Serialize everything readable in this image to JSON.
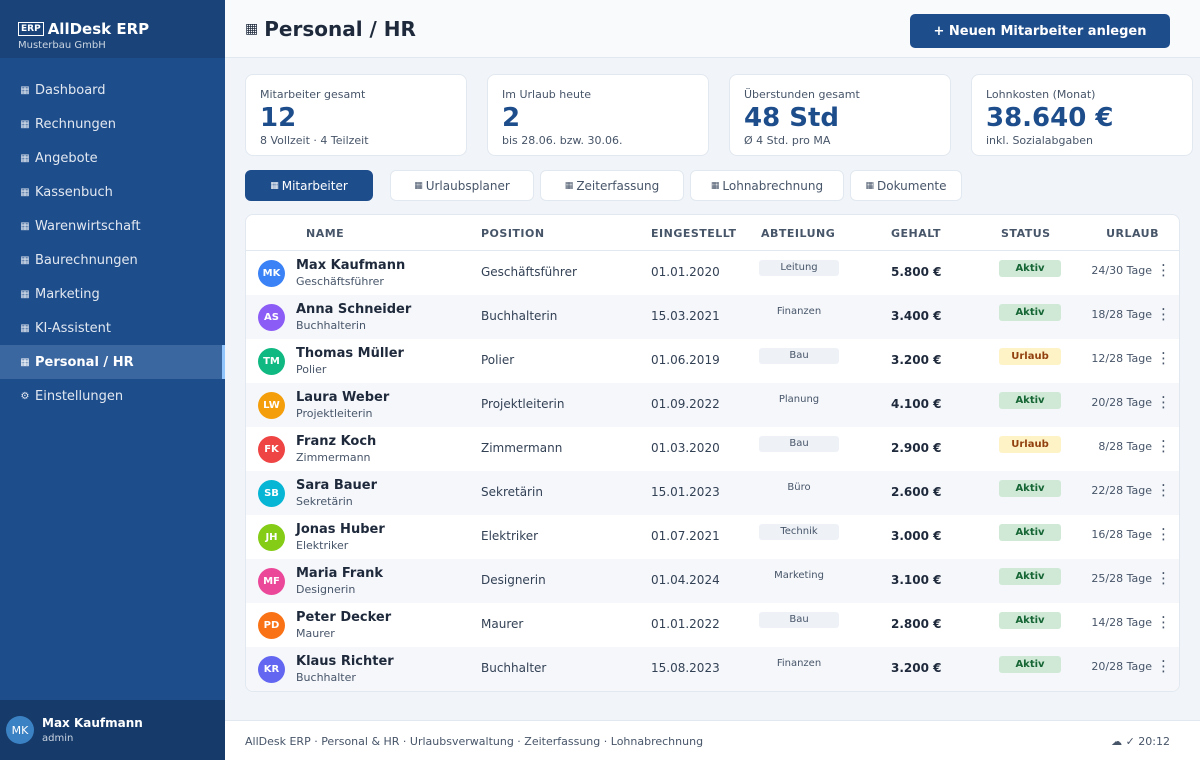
{
  "app": {
    "icon": "ERP",
    "name": "AllDesk ERP",
    "company": "Musterbau GmbH"
  },
  "sidebar": {
    "items": [
      {
        "icon": "▦",
        "label": "Dashboard"
      },
      {
        "icon": "▦",
        "label": "Rechnungen"
      },
      {
        "icon": "▦",
        "label": "Angebote"
      },
      {
        "icon": "▦",
        "label": "Kassenbuch"
      },
      {
        "icon": "▦",
        "label": "Warenwirtschaft"
      },
      {
        "icon": "▦",
        "label": "Baurechnungen"
      },
      {
        "icon": "▦",
        "label": "Marketing"
      },
      {
        "icon": "▦",
        "label": "KI-Assistent"
      },
      {
        "icon": "▦",
        "label": "Personal / HR",
        "active": true
      },
      {
        "icon": "⚙",
        "label": "Einstellungen"
      }
    ]
  },
  "user": {
    "initials": "MK",
    "name": "Max Kaufmann",
    "role": "admin"
  },
  "header": {
    "title_icon": "▦",
    "title": "Personal / HR",
    "add_button": "+ Neuen Mitarbeiter anlegen"
  },
  "stats": [
    {
      "label": "Mitarbeiter gesamt",
      "value": "12",
      "sub": "8 Vollzeit · 4 Teilzeit"
    },
    {
      "label": "Im Urlaub heute",
      "value": "2",
      "sub": "bis 28.06. bzw. 30.06."
    },
    {
      "label": "Überstunden gesamt",
      "value": "48 Std",
      "sub": "Ø 4 Std. pro MA"
    },
    {
      "label": "Lohnkosten (Monat)",
      "value": "38.640 €",
      "sub": "inkl. Sozialabgaben"
    }
  ],
  "tabs": [
    {
      "icon": "▦",
      "label": "Mitarbeiter",
      "active": true
    },
    {
      "icon": "▦",
      "label": "Urlaubsplaner"
    },
    {
      "icon": "▦",
      "label": "Zeiterfassung"
    },
    {
      "icon": "▦",
      "label": "Lohnabrechnung"
    },
    {
      "icon": "▦",
      "label": "Dokumente"
    }
  ],
  "table": {
    "columns": [
      "NAME",
      "POSITION",
      "EINGESTELLT",
      "ABTEILUNG",
      "GEHALT",
      "STATUS",
      "URLAUB"
    ],
    "rows": [
      {
        "initials": "MK",
        "name": "Max Kaufmann",
        "role": "Geschäftsführer",
        "position": "Geschäftsführer",
        "hired": "01.01.2020",
        "dept": "Leitung",
        "salary": "5.800 €",
        "status": "Aktiv",
        "vacation": "24/30 Tage",
        "color": "#3b82f6"
      },
      {
        "initials": "AS",
        "name": "Anna Schneider",
        "role": "Buchhalterin",
        "position": "Buchhalterin",
        "hired": "15.03.2021",
        "dept": "Finanzen",
        "salary": "3.400 €",
        "status": "Aktiv",
        "vacation": "18/28 Tage",
        "color": "#8b5cf6"
      },
      {
        "initials": "TM",
        "name": "Thomas Müller",
        "role": "Polier",
        "position": "Polier",
        "hired": "01.06.2019",
        "dept": "Bau",
        "salary": "3.200 €",
        "status": "Urlaub",
        "vacation": "12/28 Tage",
        "color": "#10b981"
      },
      {
        "initials": "LW",
        "name": "Laura Weber",
        "role": "Projektleiterin",
        "position": "Projektleiterin",
        "hired": "01.09.2022",
        "dept": "Planung",
        "salary": "4.100 €",
        "status": "Aktiv",
        "vacation": "20/28 Tage",
        "color": "#f59e0b"
      },
      {
        "initials": "FK",
        "name": "Franz Koch",
        "role": "Zimmermann",
        "position": "Zimmermann",
        "hired": "01.03.2020",
        "dept": "Bau",
        "salary": "2.900 €",
        "status": "Urlaub",
        "vacation": "8/28 Tage",
        "color": "#ef4444"
      },
      {
        "initials": "SB",
        "name": "Sara Bauer",
        "role": "Sekretärin",
        "position": "Sekretärin",
        "hired": "15.01.2023",
        "dept": "Büro",
        "salary": "2.600 €",
        "status": "Aktiv",
        "vacation": "22/28 Tage",
        "color": "#06b6d4"
      },
      {
        "initials": "JH",
        "name": "Jonas Huber",
        "role": "Elektriker",
        "position": "Elektriker",
        "hired": "01.07.2021",
        "dept": "Technik",
        "salary": "3.000 €",
        "status": "Aktiv",
        "vacation": "16/28 Tage",
        "color": "#84cc16"
      },
      {
        "initials": "MF",
        "name": "Maria Frank",
        "role": "Designerin",
        "position": "Designerin",
        "hired": "01.04.2024",
        "dept": "Marketing",
        "salary": "3.100 €",
        "status": "Aktiv",
        "vacation": "25/28 Tage",
        "color": "#ec4899"
      },
      {
        "initials": "PD",
        "name": "Peter Decker",
        "role": "Maurer",
        "position": "Maurer",
        "hired": "01.01.2022",
        "dept": "Bau",
        "salary": "2.800 €",
        "status": "Aktiv",
        "vacation": "14/28 Tage",
        "color": "#f97316"
      },
      {
        "initials": "KR",
        "name": "Klaus Richter",
        "role": "Buchhalter",
        "position": "Buchhalter",
        "hired": "15.08.2023",
        "dept": "Finanzen",
        "salary": "3.200 €",
        "status": "Aktiv",
        "vacation": "20/28 Tage",
        "color": "#6366f1"
      }
    ],
    "kebab": "⋮"
  },
  "footer": {
    "text": "AllDesk ERP · Personal & HR · Urlaubsverwaltung · Zeiterfassung · Lohnabrechnung",
    "status": "☁ ✓ 20:12"
  }
}
